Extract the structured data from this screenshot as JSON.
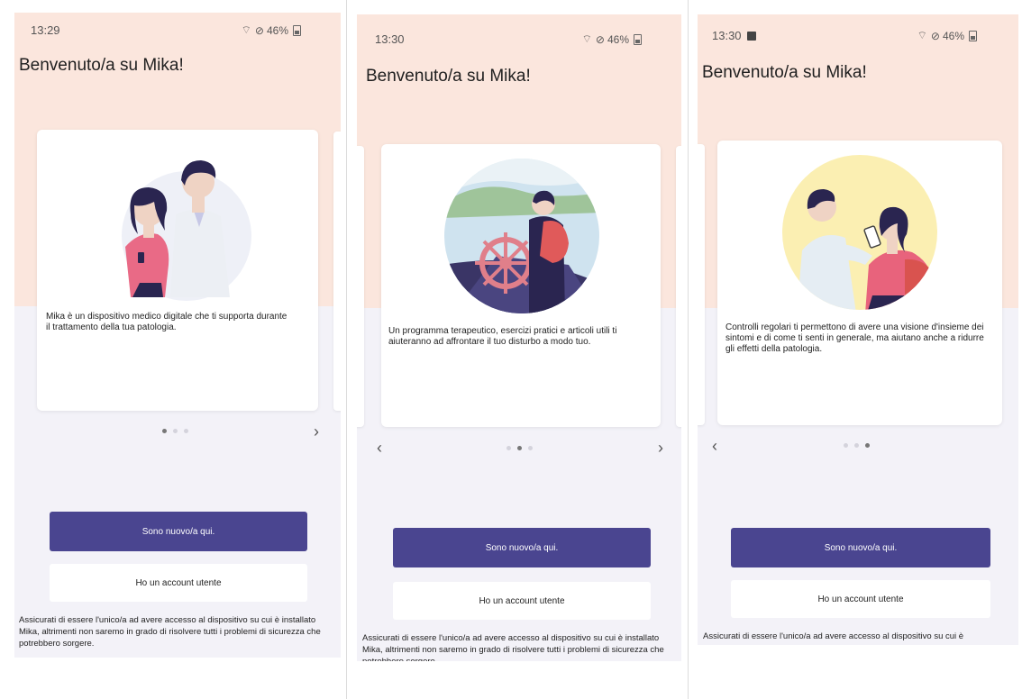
{
  "screens": [
    {
      "time": "13:29",
      "battery": "46%",
      "title": "Benvenuto/a su Mika!",
      "card_text": "Mika è un dispositivo medico digitale che ti supporta durante il trattamento della tua patologia.",
      "active_dot": 0,
      "primary_button": "Sono nuovo/a qui.",
      "secondary_button": "Ho un account utente",
      "disclaimer": "Assicurati  di essere l'unico/a ad avere accesso al dispositivo su cui è installato Mika, altrimenti non saremo in grado di risolvere tutti i problemi di sicurezza che potrebbero sorgere."
    },
    {
      "time": "13:30",
      "battery": "46%",
      "title": "Benvenuto/a su Mika!",
      "card_text": "Un programma terapeutico, esercizi pratici e articoli utili ti aiuteranno ad affrontare il tuo disturbo a modo tuo.",
      "active_dot": 1,
      "primary_button": "Sono nuovo/a qui.",
      "secondary_button": "Ho un account utente",
      "disclaimer": "Assicurati  di essere l'unico/a ad avere accesso al dispositivo su cui è installato Mika, altrimenti non saremo in grado di risolvere tutti i problemi di sicurezza che potrebbero sorgere."
    },
    {
      "time": "13:30",
      "battery": "46%",
      "title": "Benvenuto/a su Mika!",
      "card_text": "Controlli regolari ti permettono di avere una visione d'insieme dei sintomi e di come ti senti in generale, ma aiutano anche a ridurre gli effetti della patologia.",
      "active_dot": 2,
      "primary_button": "Sono nuovo/a qui.",
      "secondary_button": "Ho un account utente",
      "disclaimer": "Assicurati di essere l'unico/a ad avere accesso al dispositivo su cui è"
    }
  ],
  "colors": {
    "accent": "#4a4590",
    "peach": "#fbe6dd",
    "background": "#f3f2f8"
  },
  "icons": [
    "wifi-icon",
    "dnd-icon",
    "battery-icon",
    "image-notification-icon",
    "chevron-left-icon",
    "chevron-right-icon"
  ]
}
